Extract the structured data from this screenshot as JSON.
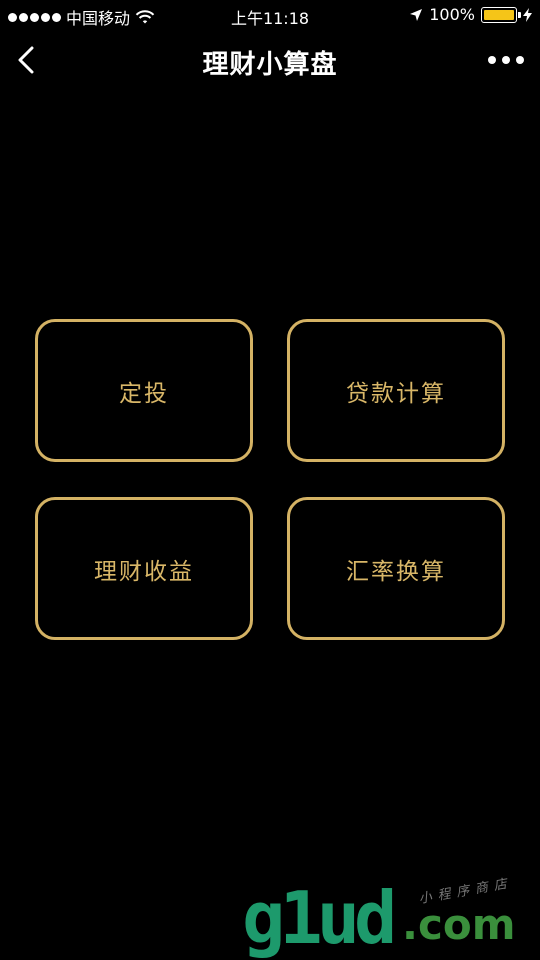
{
  "status_bar": {
    "carrier": "中国移动",
    "time": "上午11:18",
    "battery_percent": "100%",
    "battery_level": 1.0,
    "accent_color": "#f5c518"
  },
  "nav": {
    "title": "理财小算盘",
    "back_icon": "chevron-left-icon",
    "more_icon": "more-dots-icon"
  },
  "tiles": [
    {
      "label": "定投"
    },
    {
      "label": "贷款计算"
    },
    {
      "label": "理财收益"
    },
    {
      "label": "汇率换算"
    }
  ],
  "theme": {
    "background": "#000000",
    "tile_border": "#d4b264",
    "tile_text": "#d9b768"
  },
  "watermark": {
    "logo_main": "g1ud",
    "logo_suffix": ".com",
    "tagline": "小程序商店"
  }
}
